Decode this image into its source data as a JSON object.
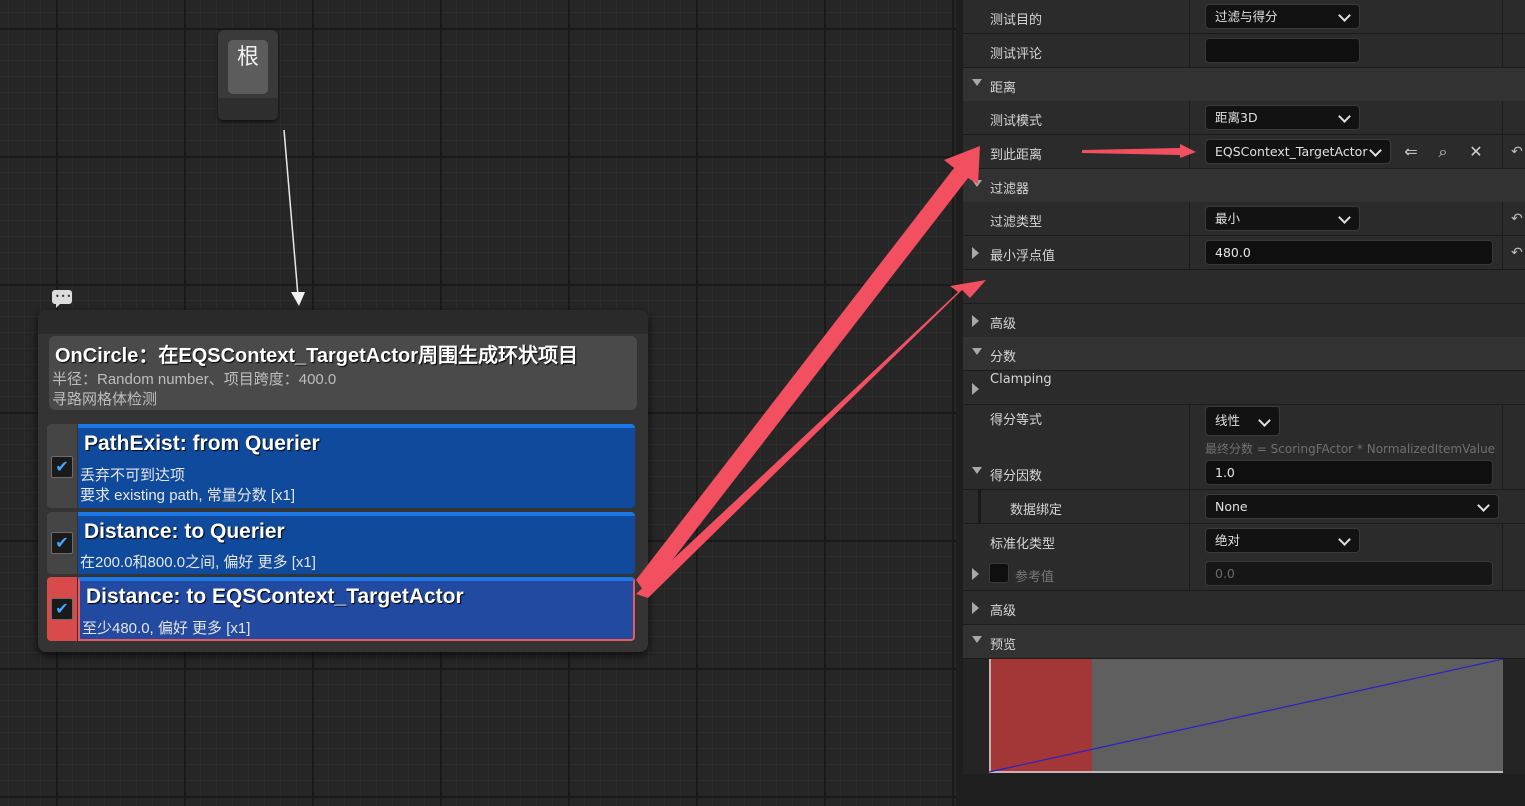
{
  "graph": {
    "root_label": "根",
    "comment_icon": "speech-bubble-icon",
    "generator": {
      "title": "OnCircle：在EQSContext_TargetActor周围生成环状项目",
      "line1": "半径：Random number、项目跨度：400.0",
      "line2": "寻路网格体检测"
    },
    "tests": [
      {
        "title": "PathExist: from Querier",
        "desc1": "丢弃不可到达项",
        "desc2": "要求 existing path, 常量分数 [x1]",
        "checked": true
      },
      {
        "title": "Distance: to Querier",
        "desc1": "在200.0和800.0之间, 偏好 更多 [x1]",
        "checked": true
      },
      {
        "title": "Distance: to EQSContext_TargetActor",
        "desc1": "至少480.0, 偏好 更多 [x1]",
        "checked": true
      }
    ],
    "check_glyph": "✔"
  },
  "details": {
    "rows": {
      "test_purpose": {
        "label": "测试目的",
        "value": "过滤与得分"
      },
      "test_comment": {
        "label": "测试评论",
        "value": ""
      },
      "distance_cat": {
        "label": "距离"
      },
      "test_mode": {
        "label": "测试模式",
        "value": "距离3D"
      },
      "distance_to": {
        "label": "到此距离",
        "value": "EQSContext_TargetActor"
      },
      "filter_cat": {
        "label": "过滤器"
      },
      "filter_type": {
        "label": "过滤类型",
        "value": "最小"
      },
      "float_min": {
        "label": "最小浮点值",
        "value": "480.0"
      },
      "advanced1": {
        "label": "高级"
      },
      "score_cat": {
        "label": "分数"
      },
      "clamping": {
        "label": "Clamping"
      },
      "score_eq": {
        "label": "得分等式",
        "value": "线性",
        "hint": "最终分数 = ScoringFActor * NormalizedItemValue"
      },
      "score_factor": {
        "label": "得分因数",
        "value": "1.0"
      },
      "data_binding": {
        "label": "数据绑定",
        "value": "None"
      },
      "norm_type": {
        "label": "标准化类型",
        "value": "绝对"
      },
      "ref_value": {
        "label": "参考值",
        "value": "0.0"
      },
      "advanced2": {
        "label": "高级"
      },
      "preview_cat": {
        "label": "预览"
      }
    },
    "icons": {
      "use_selected": "use-selected-icon",
      "browse": "browse-icon",
      "clear": "clear-icon",
      "reset": "reset-arrow-icon"
    },
    "reset_glyph": "↶",
    "clear_glyph": "✕",
    "use_glyph": "⇐",
    "browse_glyph": "⌕"
  },
  "preview": {
    "colors": {
      "filtered_region": "#a33636",
      "background": "#5f5f5f",
      "line": "#2a22c8"
    },
    "filter_threshold_fraction": 0.2,
    "line": {
      "start": 0.0,
      "end": 1.0
    }
  },
  "annotation_colors": {
    "arrow": "#f25060"
  }
}
